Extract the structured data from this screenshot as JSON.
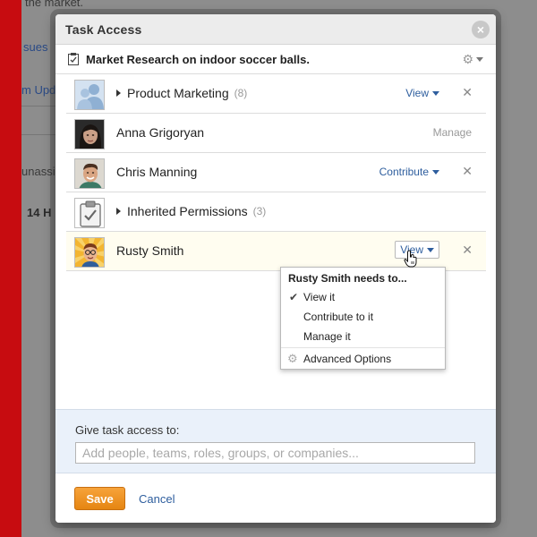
{
  "background": {
    "line1": "the market.",
    "link1": "sues",
    "link2": "m Upd",
    "text1": "unassi",
    "text2": "14 H"
  },
  "modal": {
    "title": "Task Access",
    "close_label": "×"
  },
  "task": {
    "name": "Market Research on indoor soccer balls."
  },
  "access_list": [
    {
      "name": "Product Marketing",
      "count": "(8)",
      "permission": "View",
      "removable": true,
      "avatar": "group-icon"
    },
    {
      "name": "Anna Grigoryan",
      "permission": "Manage",
      "removable": false,
      "avatar": "user-avatar"
    },
    {
      "name": "Chris Manning",
      "permission": "Contribute",
      "removable": true,
      "avatar": "user-avatar"
    },
    {
      "name": "Inherited Permissions",
      "count": "(3)",
      "removable": false,
      "avatar": "clipboard-icon"
    },
    {
      "name": "Rusty Smith",
      "permission": "View",
      "removable": true,
      "avatar": "user-avatar"
    }
  ],
  "dropdown": {
    "title": "Rusty Smith needs to...",
    "items": [
      {
        "label": "View it",
        "checked": true
      },
      {
        "label": "Contribute to it",
        "checked": false
      },
      {
        "label": "Manage it",
        "checked": false
      }
    ],
    "advanced": "Advanced Options"
  },
  "give_access": {
    "label": "Give task access to:",
    "placeholder": "Add people, teams, roles, groups, or companies..."
  },
  "footer": {
    "save_label": "Save",
    "cancel_label": "Cancel"
  },
  "colors": {
    "accent_link": "#2e5e9e",
    "save_button": "#f39a2a",
    "brand_red": "#c70c10"
  }
}
